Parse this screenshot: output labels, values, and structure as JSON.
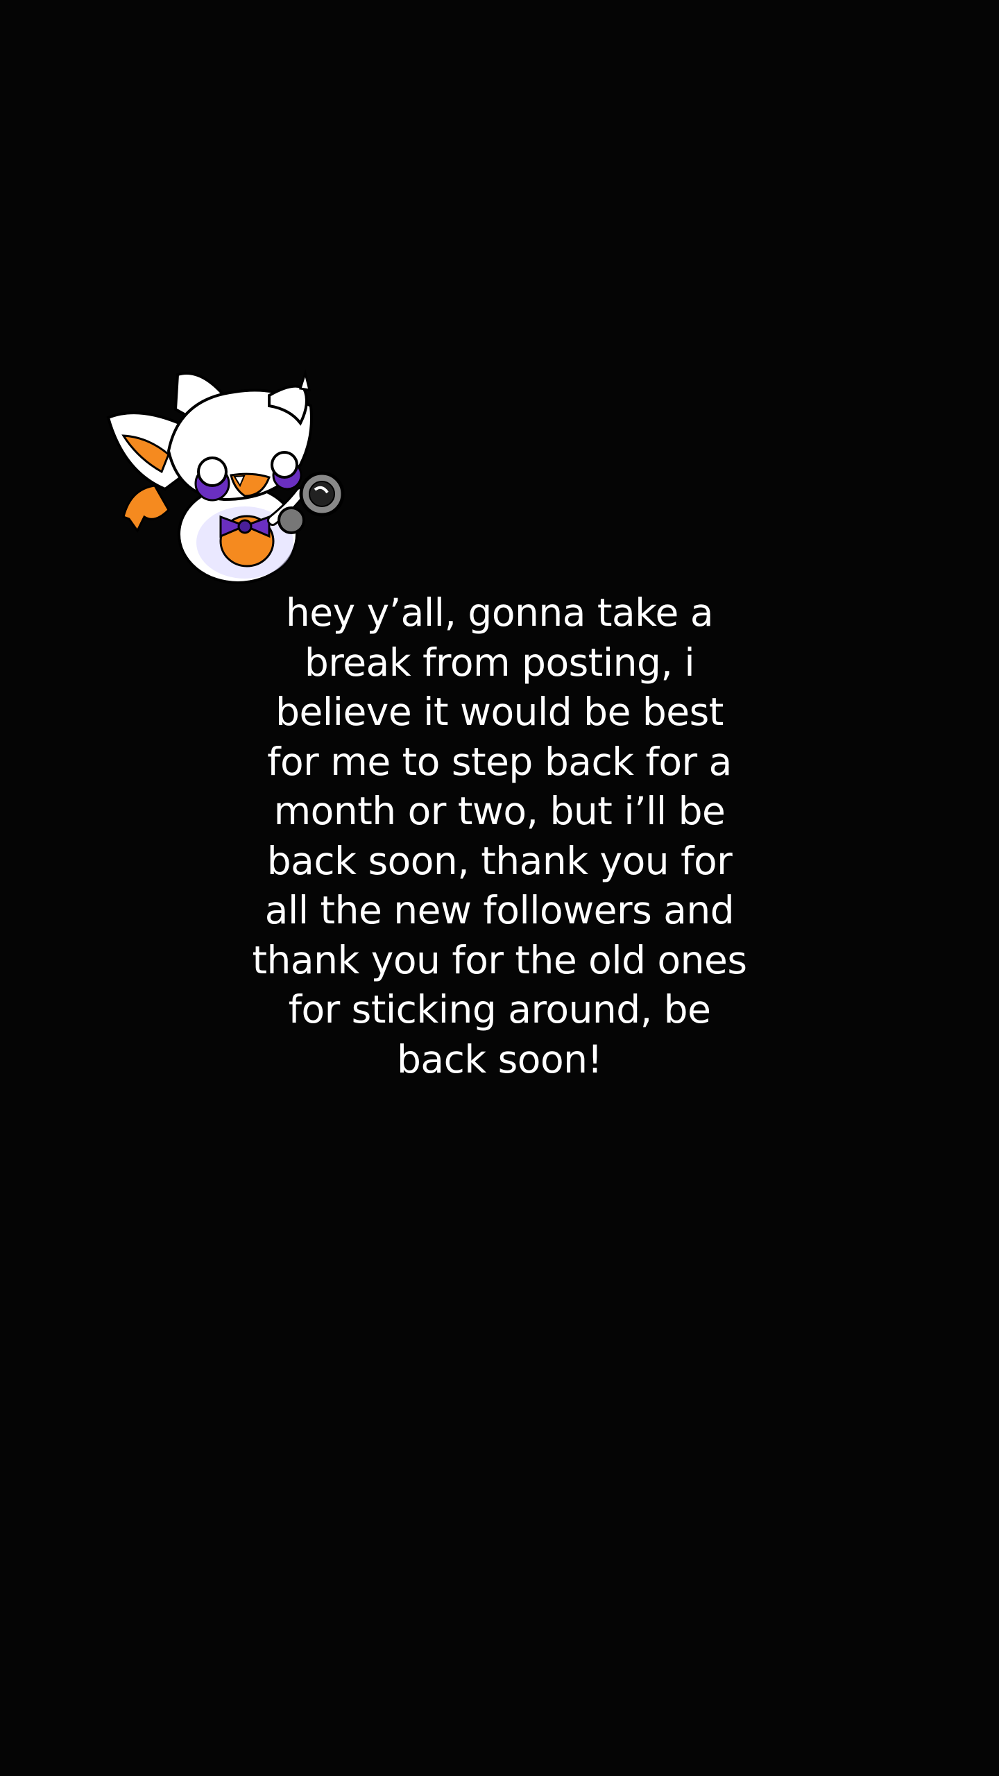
{
  "post": {
    "sticker_icon": "fox-mascot-holding-microphone-icon",
    "lines": [
      "hey y’all, gonna take a",
      "break from posting, i",
      "believe it would be best",
      "for me to step back for a",
      "month or two, but i’ll be",
      "back soon, thank you for",
      "all the new followers and",
      "thank you for the old ones",
      "for sticking around, be",
      "back soon!"
    ]
  },
  "colors": {
    "background": "#050505",
    "text": "#ffffff",
    "mascot_orange": "#f58a1f",
    "mascot_purple": "#6a2fc0"
  }
}
